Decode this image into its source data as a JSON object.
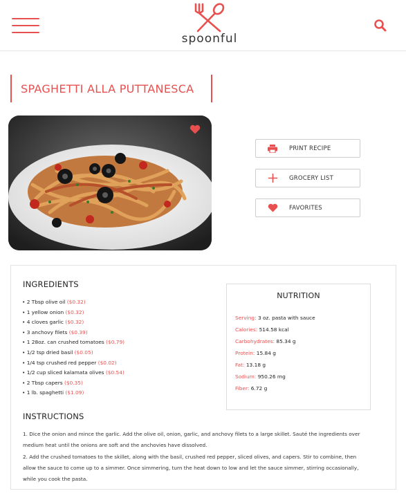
{
  "brand": {
    "name": "spoonful",
    "accent": "#e8504f"
  },
  "header": {
    "menu_icon": "hamburger-icon",
    "logo_icon": "fork-spoon-icon",
    "search_icon": "search-icon"
  },
  "recipe": {
    "title": "SPAGHETTI ALLA PUTTANESCA",
    "favorite_icon": "heart-icon"
  },
  "actions": [
    {
      "label": "PRINT RECIPE",
      "icon": "printer-icon"
    },
    {
      "label": "GROCERY LIST",
      "icon": "plus-icon"
    },
    {
      "label": "FAVORITES",
      "icon": "heart-icon"
    }
  ],
  "ingredients": {
    "title": "INGREDIENTS",
    "items": [
      {
        "text": "• 2 Tbsp olive oil",
        "price": "($0.32)"
      },
      {
        "text": "• 1 yellow onion",
        "price": "($0.32)"
      },
      {
        "text": "• 4 cloves garlic",
        "price": "($0.32)"
      },
      {
        "text": "• 3 anchovy filets",
        "price": "($0.39)"
      },
      {
        "text": "• 1 28oz. can crushed tomatoes",
        "price": "($0.79)"
      },
      {
        "text": "• 1/2 tsp dried basil",
        "price": "($0.05)"
      },
      {
        "text": "• 1/4 tsp crushed red pepper",
        "price": "($0.02)"
      },
      {
        "text": "• 1/2 cup sliced kalamata olives",
        "price": "($0.54)"
      },
      {
        "text": "• 2 Tbsp capers",
        "price": "($0.35)"
      },
      {
        "text": "• 1 lb. spaghetti",
        "price": "($1.09)"
      }
    ]
  },
  "nutrition": {
    "title": "NUTRITION",
    "rows": [
      {
        "key": "Serving:",
        "value": "3 oz. pasta with sauce"
      },
      {
        "key": "Calories:",
        "value": "514.58 kcal"
      },
      {
        "key": "Carbohydrates:",
        "value": "85.34 g"
      },
      {
        "key": "Protein:",
        "value": "15.84 g"
      },
      {
        "key": "Fat:",
        "value": "13.18 g"
      },
      {
        "key": "Sodium:",
        "value": "950.26 mg"
      },
      {
        "key": "Fiber:",
        "value": "6.72 g"
      }
    ]
  },
  "instructions": {
    "title": "INSTRUCTIONS",
    "steps": [
      "1. Dice the onion and mince the garlic. Add the olive oil, onion, garlic, and anchovy filets to a large skillet. Sauté the ingredients over medium heat until the onions are soft and the anchovies have dissolved.",
      "2. Add the crushed tomatoes to the skillet, along with the basil, crushed red pepper, sliced olives, and capers. Stir to combine, then allow the sauce to come up to a simmer. Once simmering, turn the heat down to low and let the sauce simmer, stirring occasionally, while you cook the pasta."
    ]
  }
}
